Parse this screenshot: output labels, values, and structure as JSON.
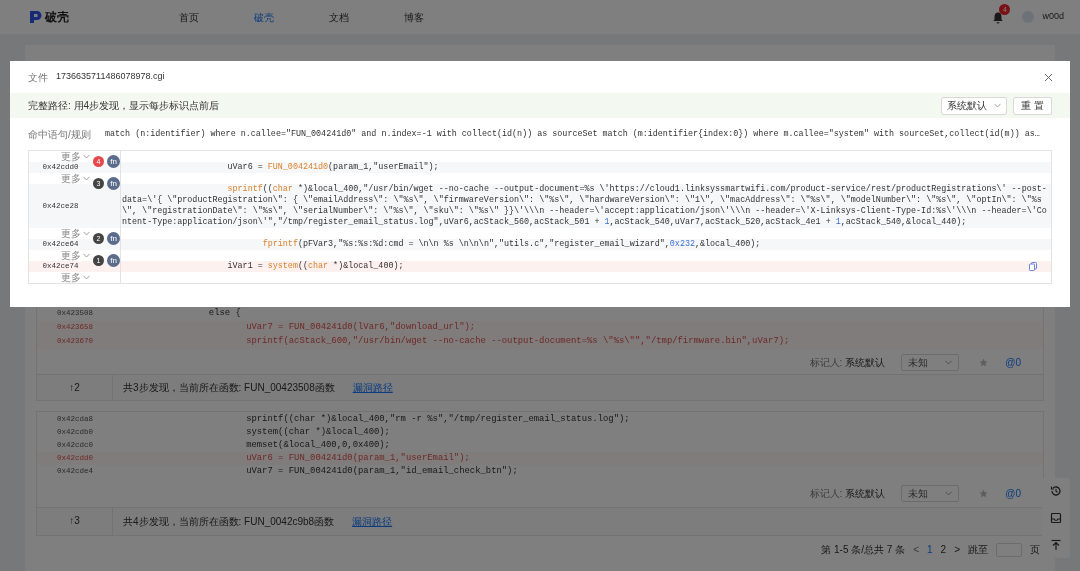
{
  "nav": {
    "logo": "破壳",
    "tabs": [
      {
        "label": "首页",
        "selected": false
      },
      {
        "label": "破壳",
        "selected": true
      },
      {
        "label": "文档",
        "selected": false
      },
      {
        "label": "博客",
        "selected": false
      }
    ],
    "notification_count": "4",
    "username": "w00d"
  },
  "results": [
    {
      "lines": [
        {
          "address": "0x423508",
          "code": "                  else {",
          "hit": false
        },
        {
          "address": "0x423658",
          "code": "                         uVar7 = FUN_004241d0(lVar6,\"download_url\");",
          "hit": true
        },
        {
          "address": "0x423670",
          "code": "                         sprintf(acStack_600,\"/usr/bin/wget --no-cache --output-document=%s \\\"%s\\\"\",\"/tmp/firmware.bin\",uVar7);",
          "hit": true
        }
      ],
      "marker_label": "标记人:",
      "marker_value": "系统默认",
      "status": "未知",
      "count": "@0",
      "path_index": "↑2",
      "summary": "共3步发现，当前所在函数: FUN_00423508函数",
      "link": "漏洞路径"
    },
    {
      "lines": [
        {
          "address": "0x42cda8",
          "code": "                         sprintf((char *)&local_400,\"rm -r %s\",\"/tmp/register_email_status.log\");",
          "hit": false
        },
        {
          "address": "0x42cdb0",
          "code": "                         system((char *)&local_400);",
          "hit": false
        },
        {
          "address": "0x42cdc0",
          "code": "                         memset(&local_400,0,0x400);",
          "hit": false
        },
        {
          "address": "0x42cdd0",
          "code": "                         uVar6 = FUN_004241d0(param_1,\"userEmail\");",
          "hit": true
        },
        {
          "address": "0x42cde4",
          "code": "                         uVar7 = FUN_004241d0(param_1,\"id_email_check_btn\");",
          "hit": false
        }
      ],
      "marker_label": "标记人:",
      "marker_value": "系统默认",
      "status": "未知",
      "count": "@0",
      "path_index": "↑3",
      "summary": "共4步发现，当前所在函数: FUN_0042c9b8函数",
      "link": "漏洞路径"
    }
  ],
  "pagination": {
    "summary": "第 1-5 条/总共 7 条",
    "prev": "<",
    "pages": [
      {
        "label": "1",
        "selected": true
      },
      {
        "label": "2",
        "selected": false
      }
    ],
    "next": ">",
    "jump_label": "跳至",
    "page_unit": "页"
  },
  "modal": {
    "file_label": "文件",
    "file_name": "1736635711486078978.cgi",
    "path_summary": "完整路径: 用4步发现，显示每步标识点前后",
    "marker_select": "系统默认",
    "reset_button": "重 置",
    "rule_label": "命中语句/规则",
    "rule": "match (n:identifier) where n.callee=\"FUN_004241d0\" and n.index=-1 with collect(id(n)) as sourceSet match (m:identifier{index:0}) where m.callee=\"system\" with sourceSet,collect(id(m)) as…",
    "steps": [
      {
        "more": "更多",
        "step": "4",
        "color": "#e5484d",
        "fn_label": "fn",
        "address": "0x42cdd0",
        "highlighted": false,
        "code": [
          {
            "text": "                     uVar6 = ",
            "kind": "plain"
          },
          {
            "text": "FUN_004241d0",
            "kind": "fn"
          },
          {
            "text": "(param_1,\"userEmail\");",
            "kind": "plain"
          }
        ]
      },
      {
        "more": "更多",
        "step": "3",
        "color": "#444444",
        "fn_label": "fn",
        "address": "0x42ce28",
        "highlighted": false,
        "code": [
          {
            "text": "                     sprintf",
            "kind": "fn"
          },
          {
            "text": "((",
            "kind": "plain"
          },
          {
            "text": "char",
            "kind": "kw"
          },
          {
            "text": " *)&local_400,\"/usr/bin/wget --no-cache --output-document=%s \\'https://cloud1.linksyssmartwifi.com/product-service/rest/productRegistrations\\' --post-data=\\'{ \\\"productRegistration\\\": { \\\"emailAddress\\\": \\\"%s\\\", \\\"firmwareVersion\\\": \\\"%s\\\", \\\"hardwareVersion\\\": \\\"1\\\", \\\"macAddress\\\": \\\"%s\\\", \\\"modelNumber\\\": \\\"%s\\\", \\\"optIn\\\": \\\"%s\\\", \\\"registrationDate\\\": \\\"%s\\\", \\\"serialNumber\\\": \\\"%s\\\", \\\"sku\\\": \\\"%s\\\" }}\\'\\\\\\n --header=\\'accept:application/json\\'\\\\\\n --header=\\'X-Linksys-Client-Type-Id:%s\\'\\\\\\n --header=\\'Content-Type:application/json\\'\",\"/tmp/register_email_status.log\",uVar6,acStack_560,acStack_501 + ",
            "kind": "plain"
          },
          {
            "text": "1",
            "kind": "num"
          },
          {
            "text": ",acStack_540,uVar7,acStack_520,acStack_4e1 + ",
            "kind": "plain"
          },
          {
            "text": "1",
            "kind": "num"
          },
          {
            "text": ",acStack_540,&local_440);",
            "kind": "plain"
          }
        ]
      },
      {
        "more": "更多",
        "step": "2",
        "color": "#444444",
        "fn_label": "fn",
        "address": "0x42ce64",
        "highlighted": false,
        "code": [
          {
            "text": "                            fprintf",
            "kind": "fn"
          },
          {
            "text": "(pFVar3,\"%s:%s:%d:cmd = \\n\\n %s \\n\\n\\n\",\"utils.c\",\"register_email_wizard\",",
            "kind": "plain"
          },
          {
            "text": "0x232",
            "kind": "num"
          },
          {
            "text": ",&local_400);",
            "kind": "plain"
          }
        ]
      },
      {
        "more": "更多",
        "step": "1",
        "color": "#444444",
        "fn_label": "fn",
        "address": "0x42ce74",
        "highlighted": true,
        "code": [
          {
            "text": "                     iVar1 = ",
            "kind": "plain"
          },
          {
            "text": "system",
            "kind": "fn"
          },
          {
            "text": "((",
            "kind": "plain"
          },
          {
            "text": "char",
            "kind": "kw"
          },
          {
            "text": " *)&local_400);",
            "kind": "plain"
          }
        ]
      }
    ],
    "trailing_more": "更多"
  }
}
